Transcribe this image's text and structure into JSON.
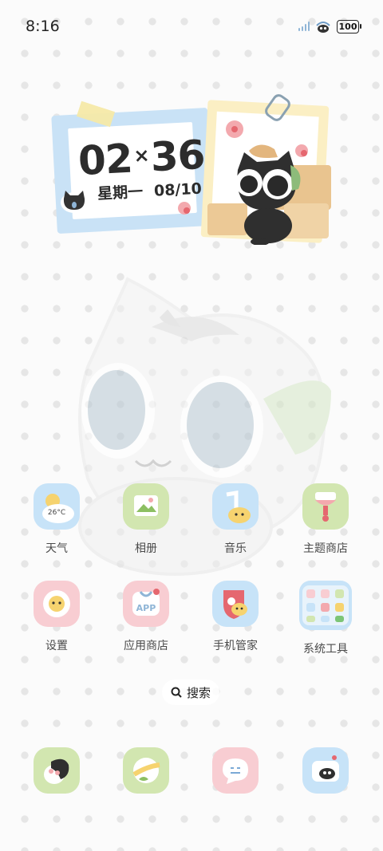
{
  "status_bar": {
    "time": "8:16",
    "battery": "100"
  },
  "clock_widget": {
    "hours": "02",
    "minutes": "36",
    "separator": "×",
    "weekday": "星期一",
    "date": "08/10"
  },
  "apps": [
    {
      "label": "天气",
      "icon": "weather-icon",
      "color": "#c7e3f8",
      "temp": "26°C"
    },
    {
      "label": "相册",
      "icon": "gallery-icon",
      "color": "#d2e6b0"
    },
    {
      "label": "音乐",
      "icon": "music-icon",
      "color": "#c7e3f8"
    },
    {
      "label": "主题商店",
      "icon": "theme-store-icon",
      "color": "#d2e6b0"
    },
    {
      "label": "设置",
      "icon": "settings-icon",
      "color": "#f8cdd2"
    },
    {
      "label": "应用商店",
      "icon": "app-store-icon",
      "color": "#f8cdd2",
      "badge": "APP"
    },
    {
      "label": "手机管家",
      "icon": "phone-manager-icon",
      "color": "#c7e3f8"
    },
    {
      "label": "系统工具",
      "icon": "system-tools-folder-icon",
      "color": "#c7e3f8"
    }
  ],
  "search": {
    "label": "搜索"
  },
  "dock": [
    {
      "icon": "phone-icon",
      "color": "#d2e6b0"
    },
    {
      "icon": "browser-icon",
      "color": "#d2e6b0"
    },
    {
      "icon": "messages-icon",
      "color": "#f8cdd2"
    },
    {
      "icon": "camera-icon",
      "color": "#c7e3f8"
    }
  ]
}
